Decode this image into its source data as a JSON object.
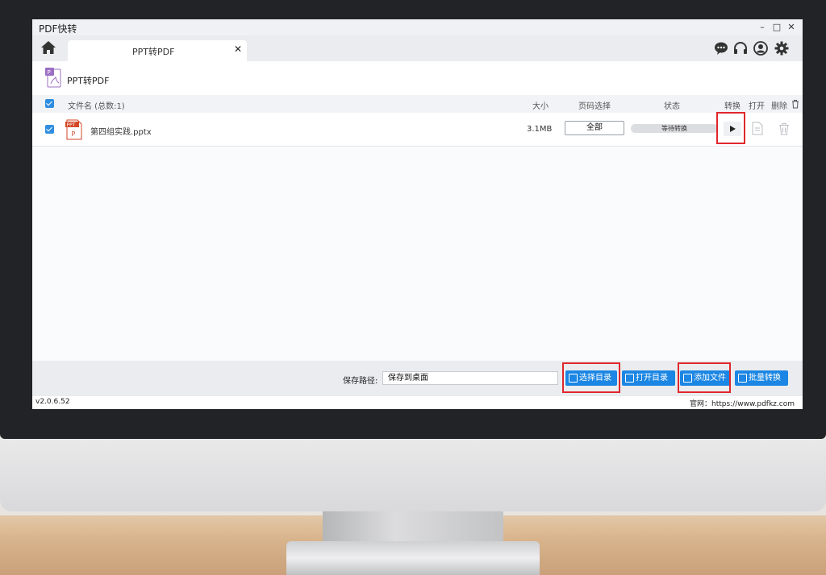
{
  "app": {
    "title": "PDF快转",
    "window_controls": {
      "minimize": "–",
      "maximize": "□",
      "close": "✕"
    }
  },
  "tabs": [
    {
      "label": "PPT转PDF",
      "close": "✕"
    }
  ],
  "top_icons": [
    "chat-icon",
    "headset-icon",
    "user-icon",
    "gear-icon"
  ],
  "tool": {
    "title": "PPT转PDF",
    "icon": "ppt-to-pdf-icon"
  },
  "list": {
    "header": {
      "filename": "文件名 (总数:1)",
      "size": "大小",
      "page_select": "页码选择",
      "status": "状态",
      "convert": "转换",
      "open": "打开",
      "delete": "删除"
    },
    "rows": [
      {
        "checked": true,
        "name": "第四组实践.pptx",
        "size": "3.1MB",
        "pages": "全部",
        "status": "等待转换"
      }
    ]
  },
  "bottom": {
    "save_label": "保存路径:",
    "save_value": "保存到桌面",
    "buttons": {
      "select_dir": "选择目录",
      "open_dir": "打开目录",
      "add_file": "添加文件",
      "batch_convert": "批量转换"
    }
  },
  "status_bar": {
    "version": "v2.0.6.52",
    "website": "官网：https://www.pdfkz.com"
  },
  "colors": {
    "accent": "#1b86e3",
    "highlight": "#e0272d",
    "checkbox": "#2f8ee0"
  }
}
